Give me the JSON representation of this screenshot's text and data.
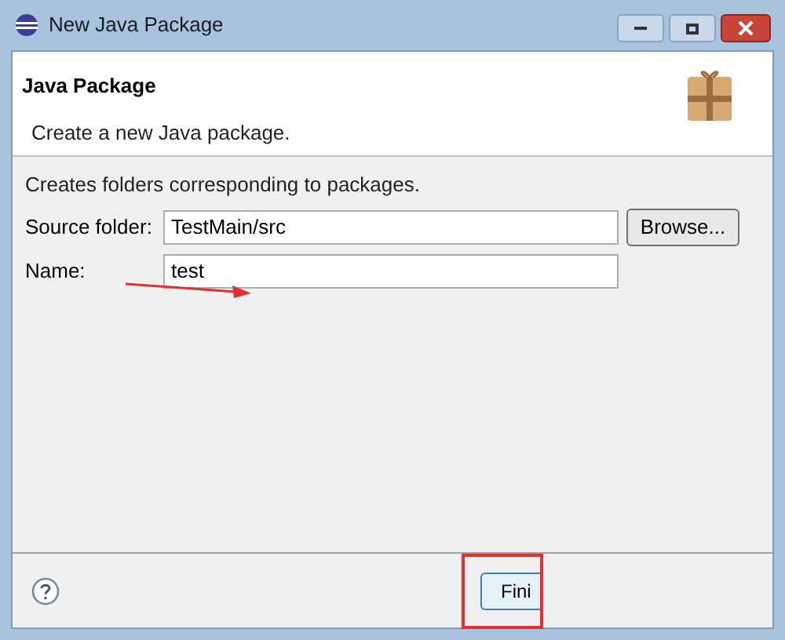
{
  "window": {
    "title": "New Java Package"
  },
  "header": {
    "title": "Java Package",
    "subtitle": "Create a new Java package."
  },
  "description": "Creates folders corresponding to packages.",
  "fields": [
    {
      "label": "Source folder:",
      "value": "TestMain/src",
      "button": "Browse..."
    },
    {
      "label": "Name:",
      "value": "test"
    }
  ],
  "footer": {
    "buttons": [
      "Fini"
    ]
  }
}
